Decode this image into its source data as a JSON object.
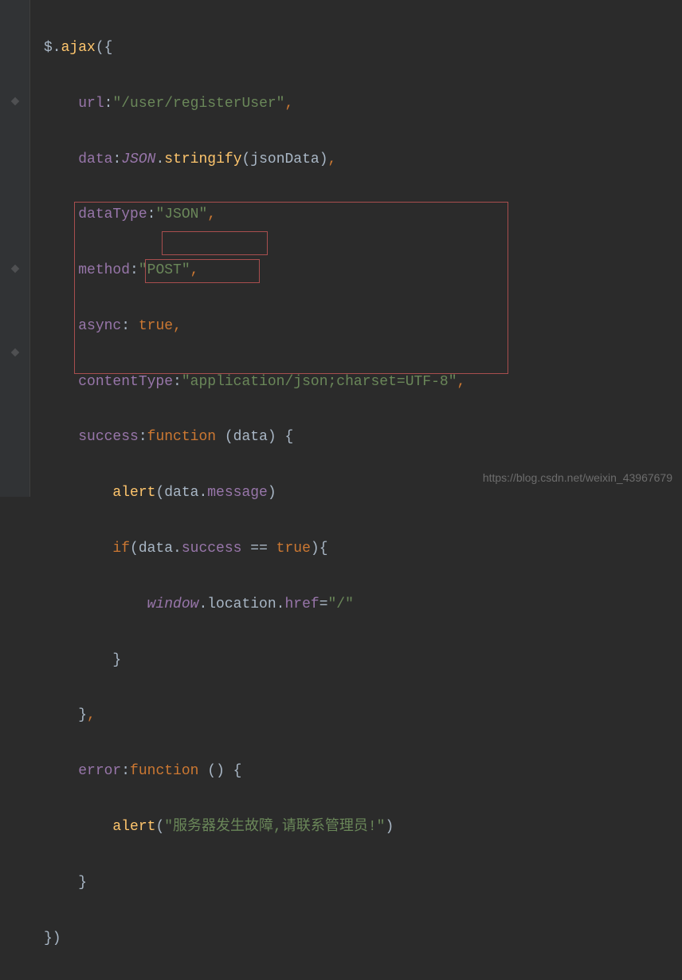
{
  "code": {
    "line1_a": "$.",
    "line1_b": "ajax",
    "line1_c": "({",
    "line2_a": "url",
    "line2_b": ":",
    "line2_c": "\"/user/registerUser\"",
    "line2_d": ",",
    "line3_a": "data",
    "line3_b": ":",
    "line3_c": "JSON",
    "line3_d": ".",
    "line3_e": "stringify",
    "line3_f": "(jsonData)",
    "line3_g": ",",
    "line4_a": "dataType",
    "line4_b": ":",
    "line4_c": "\"JSON\"",
    "line4_d": ",",
    "line5_a": "method",
    "line5_b": ":",
    "line5_c": "\"POST\"",
    "line5_d": ",",
    "line6_a": "async",
    "line6_b": ": ",
    "line6_c": "true",
    "line6_d": ",",
    "line7_a": "contentType",
    "line7_b": ":",
    "line7_c": "\"application/json;charset=UTF-8\"",
    "line7_d": ",",
    "line8_a": "success",
    "line8_b": ":",
    "line8_c": "function ",
    "line8_d": "(data) {",
    "line9_a": "alert",
    "line9_b": "(data.",
    "line9_c": "message",
    "line9_d": ")",
    "line10_a": "if",
    "line10_b": "(data.",
    "line10_c": "success ",
    "line10_d": "== ",
    "line10_e": "true",
    "line10_f": "){",
    "line11_a": "window",
    "line11_b": ".location.",
    "line11_c": "href",
    "line11_d": "=",
    "line11_e": "\"/\"",
    "line12_a": "}",
    "line13_a": "}",
    "line13_b": ",",
    "line14_a": "error",
    "line14_b": ":",
    "line14_c": "function ",
    "line14_d": "() {",
    "line15_a": "alert",
    "line15_b": "(",
    "line15_c": "\"服务器发生故障,请联系管理员!\"",
    "line15_d": ")",
    "line16_a": "}",
    "line17_a": "})"
  },
  "watermark": "https://blog.csdn.net/weixin_43967679"
}
